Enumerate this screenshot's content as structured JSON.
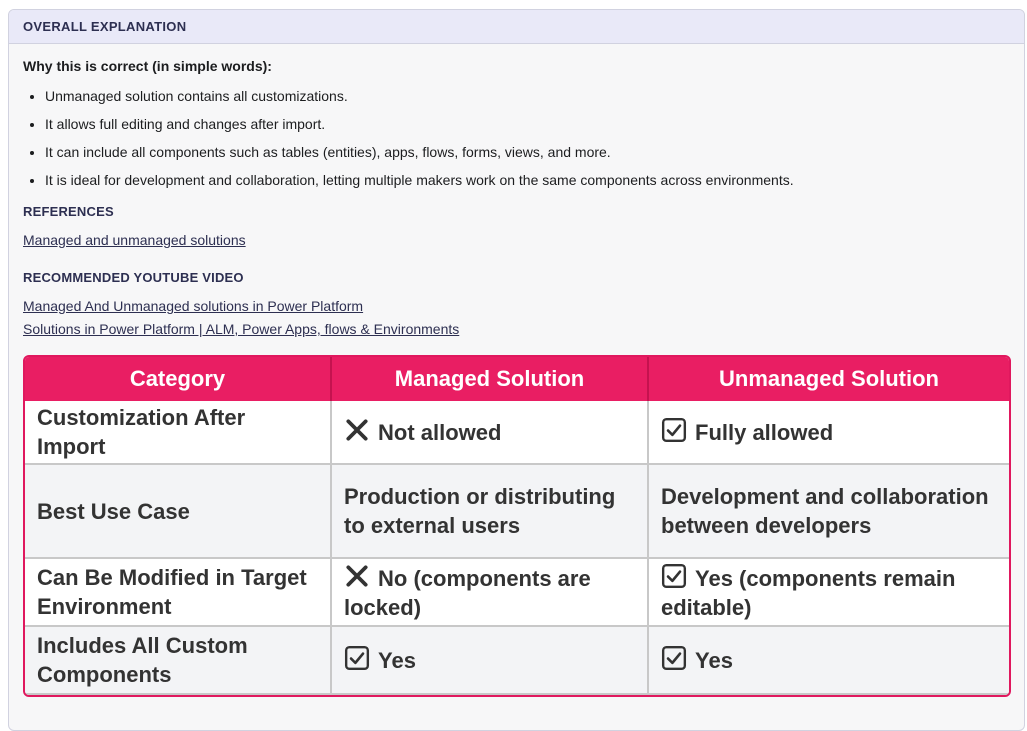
{
  "panel": {
    "header": "OVERALL EXPLANATION",
    "why_heading": "Why this is correct (in simple words):",
    "points": [
      "Unmanaged solution contains all customizations.",
      "It allows full editing and changes after import.",
      "It can include all components such as tables (entities), apps, flows, forms, views, and more.",
      "It is ideal for development and collaboration, letting multiple makers work on the same components across environments."
    ],
    "references_label": "REFERENCES",
    "references": [
      "Managed and unmanaged solutions"
    ],
    "video_label": "RECOMMENDED YOUTUBE VIDEO",
    "videos": [
      "Managed And Unmanaged solutions in Power Platform",
      "Solutions in Power Platform | ALM, Power Apps, flows & Environments"
    ]
  },
  "table": {
    "headers": [
      "Category",
      "Managed Solution",
      "Unmanaged Solution"
    ],
    "rows": [
      {
        "category": "Customization After Import",
        "managed": "Not allowed",
        "managed_icon": "x-mark-icon",
        "unmanaged": "Fully allowed",
        "unmanaged_icon": "checkbox-icon"
      },
      {
        "category": "Best Use Case",
        "managed": "Production or distributing to external users",
        "managed_icon": "",
        "unmanaged": "Development and collaboration between developers",
        "unmanaged_icon": ""
      },
      {
        "category": "Can Be Modified in Target Environment",
        "managed": "No (components are locked)",
        "managed_icon": "x-mark-icon",
        "unmanaged": "Yes (components remain editable)",
        "unmanaged_icon": "checkbox-icon"
      },
      {
        "category": "Includes All Custom Components",
        "managed": "Yes",
        "managed_icon": "checkbox-icon",
        "unmanaged": "Yes",
        "unmanaged_icon": "checkbox-icon"
      }
    ]
  },
  "colors": {
    "header_pink": "#e91e63",
    "panel_header_bg": "#e9e9f8",
    "link": "#2d2f51"
  }
}
